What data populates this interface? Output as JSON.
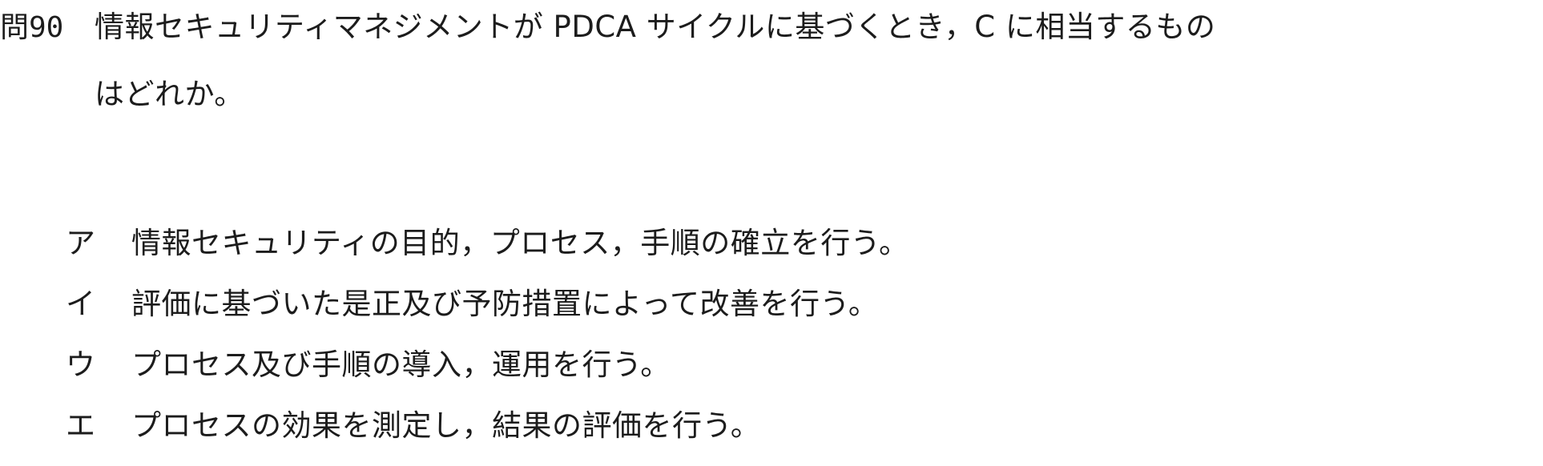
{
  "question": {
    "number": "問90",
    "line1": "情報セキュリティマネジメントが PDCA サイクルに基づくとき，C に相当するもの",
    "line2": "はどれか。"
  },
  "choices": [
    {
      "label": "ア",
      "text": "情報セキュリティの目的，プロセス，手順の確立を行う。"
    },
    {
      "label": "イ",
      "text": "評価に基づいた是正及び予防措置によって改善を行う。"
    },
    {
      "label": "ウ",
      "text": "プロセス及び手順の導入，運用を行う。"
    },
    {
      "label": "エ",
      "text": "プロセスの効果を測定し，結果の評価を行う。"
    }
  ]
}
